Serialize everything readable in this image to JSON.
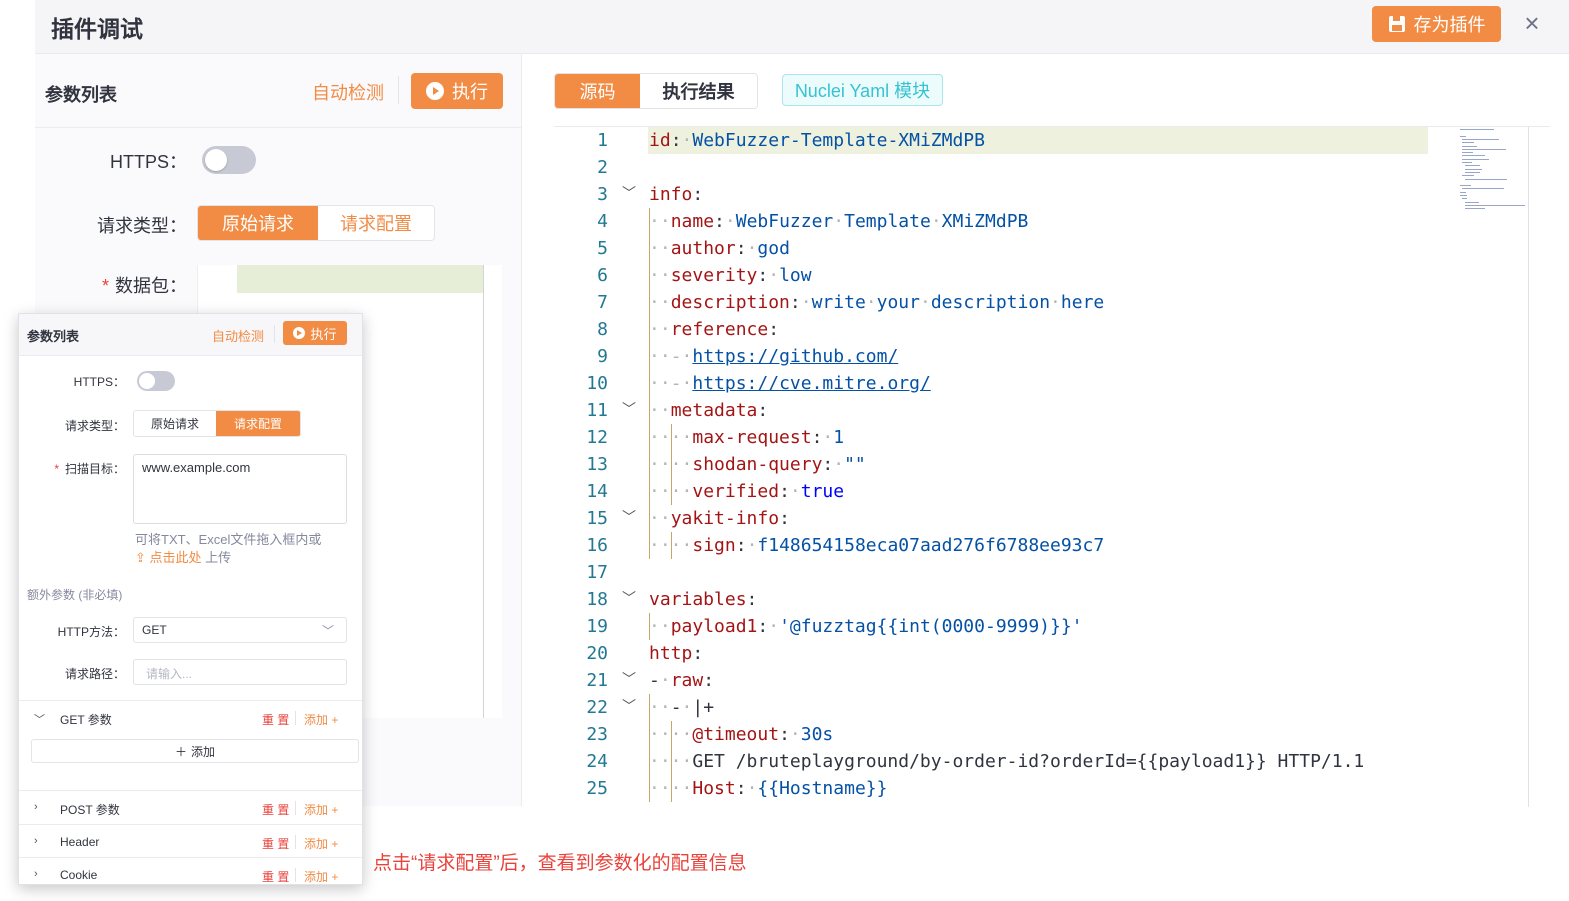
{
  "modal": {
    "title": "插件调试",
    "save_label": "存为插件",
    "close_symbol": "×"
  },
  "left": {
    "title": "参数列表",
    "auto_detect": "自动检测",
    "execute": "执行",
    "https_label": "HTTPS：",
    "https_on": false,
    "req_type_label": "请求类型：",
    "req_type_options": [
      "原始请求",
      "请求配置"
    ],
    "req_type_selected": "原始请求",
    "packet_label": "数据包："
  },
  "right": {
    "tabs": [
      "源码",
      "执行结果"
    ],
    "active_tab": "源码",
    "tag": "Nuclei Yaml 模块"
  },
  "code_lines": [
    {
      "n": "1",
      "t": "id: WebFuzzer-Template-XMiZMdPB"
    },
    {
      "n": "2",
      "t": ""
    },
    {
      "n": "3",
      "t": "info:"
    },
    {
      "n": "4",
      "t": "  name: WebFuzzer Template XMiZMdPB"
    },
    {
      "n": "5",
      "t": "  author: god"
    },
    {
      "n": "6",
      "t": "  severity: low"
    },
    {
      "n": "7",
      "t": "  description: write your description here"
    },
    {
      "n": "8",
      "t": "  reference:"
    },
    {
      "n": "9",
      "t": "  - https://github.com/"
    },
    {
      "n": "10",
      "t": "  - https://cve.mitre.org/"
    },
    {
      "n": "11",
      "t": "  metadata:"
    },
    {
      "n": "12",
      "t": "    max-request: 1"
    },
    {
      "n": "13",
      "t": "    shodan-query: \"\""
    },
    {
      "n": "14",
      "t": "    verified: true"
    },
    {
      "n": "15",
      "t": "  yakit-info:"
    },
    {
      "n": "16",
      "t": "    sign: f148654158eca07aad276f6788ee93c7"
    },
    {
      "n": "17",
      "t": ""
    },
    {
      "n": "18",
      "t": "variables:"
    },
    {
      "n": "19",
      "t": "  payload1: '@fuzztag{{int(0000-9999)}}'"
    },
    {
      "n": "20",
      "t": "http:"
    },
    {
      "n": "21",
      "t": "- raw:"
    },
    {
      "n": "22",
      "t": "  - |+"
    },
    {
      "n": "23",
      "t": "    @timeout: 30s"
    },
    {
      "n": "24",
      "t": "    GET /bruteplayground/by-order-id?orderId={{payload1}} HTTP/1.1"
    },
    {
      "n": "25",
      "t": "    Host: {{Hostname}}"
    }
  ],
  "overlay": {
    "title": "参数列表",
    "auto_detect": "自动检测",
    "execute": "执行",
    "https_label": "HTTPS：",
    "req_type_label": "请求类型：",
    "req_type_options": [
      "原始请求",
      "请求配置"
    ],
    "req_type_selected": "请求配置",
    "scan_target_label": "扫描目标：",
    "scan_target_value": "www.example.com",
    "hint_line1": "可将TXT、Excel文件拖入框内或",
    "hint_click": "点击此处",
    "hint_upload": "上传",
    "extra_section": "额外参数 (非必填)",
    "http_method_label": "HTTP方法：",
    "http_method_value": "GET",
    "path_label": "请求路径：",
    "path_placeholder": "请输入...",
    "groups": [
      {
        "name": "GET 参数",
        "reset": "重 置",
        "add": "添加 +",
        "expanded": true
      },
      {
        "name": "POST 参数",
        "reset": "重 置",
        "add": "添加 +",
        "expanded": false
      },
      {
        "name": "Header",
        "reset": "重 置",
        "add": "添加 +",
        "expanded": false
      },
      {
        "name": "Cookie",
        "reset": "重 置",
        "add": "添加 +",
        "expanded": false
      }
    ],
    "add_button": "添加"
  },
  "caption": "点击“请求配置”后，查看到参数化的配置信息",
  "colors": {
    "accent": "#f28b44",
    "danger": "#e9423b",
    "cyan": "#35c3d2"
  }
}
